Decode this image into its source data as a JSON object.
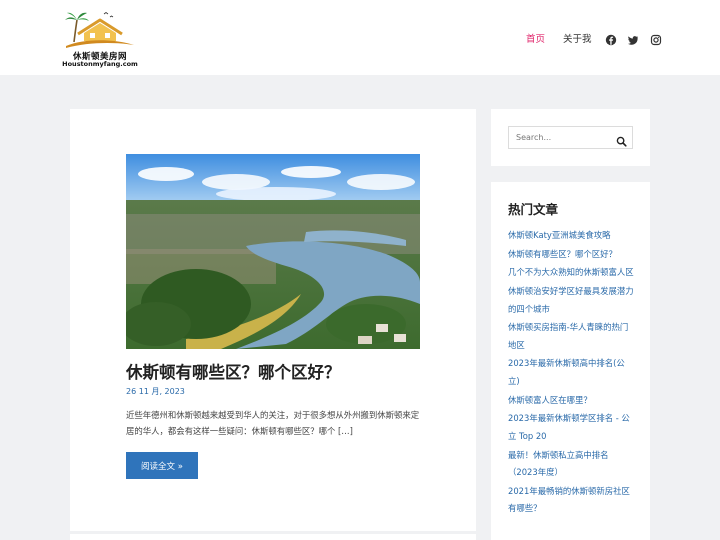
{
  "header": {
    "logo_cn": "休斯顿美房网",
    "logo_en": "Houstonmyfang.com",
    "nav": [
      {
        "label": "首页",
        "active": true
      },
      {
        "label": "关于我",
        "active": false
      }
    ],
    "social_icons": [
      "facebook-icon",
      "twitter-icon",
      "instagram-icon"
    ]
  },
  "article": {
    "title": "休斯顿有哪些区？哪个区好？",
    "date": "26 11 月, 2023",
    "excerpt": "近些年德州和休斯顿越来越受到华人的关注，对于很多想从外州搬到休斯顿来定居的华人，都会有这样一些疑问：休斯顿有哪些区？哪个 […]",
    "read_more": "阅读全文 »"
  },
  "sidebar": {
    "search_placeholder": "Search...",
    "popular_title": "热门文章",
    "popular_posts": [
      "休斯顿Katy亚洲城美食攻略",
      "休斯顿有哪些区？哪个区好？",
      "几个不为大众熟知的休斯顿富人区",
      "休斯顿治安好学区好最具发展潜力的四个城市",
      "休斯顿买房指南-华人青睐的热门地区",
      "2023年最新休斯顿高中排名(公立)",
      "休斯顿富人区在哪里？",
      "2023年最新休斯顿学区排名 - 公立 Top 20",
      "最新！休斯顿私立高中排名（2023年度）",
      "2021年最畅销的休斯顿新房社区有哪些？"
    ]
  },
  "colors": {
    "accent_link": "#2a6aa9",
    "nav_active": "#e0266b",
    "button": "#2f74bb",
    "page_bg": "#f0f1f3"
  }
}
